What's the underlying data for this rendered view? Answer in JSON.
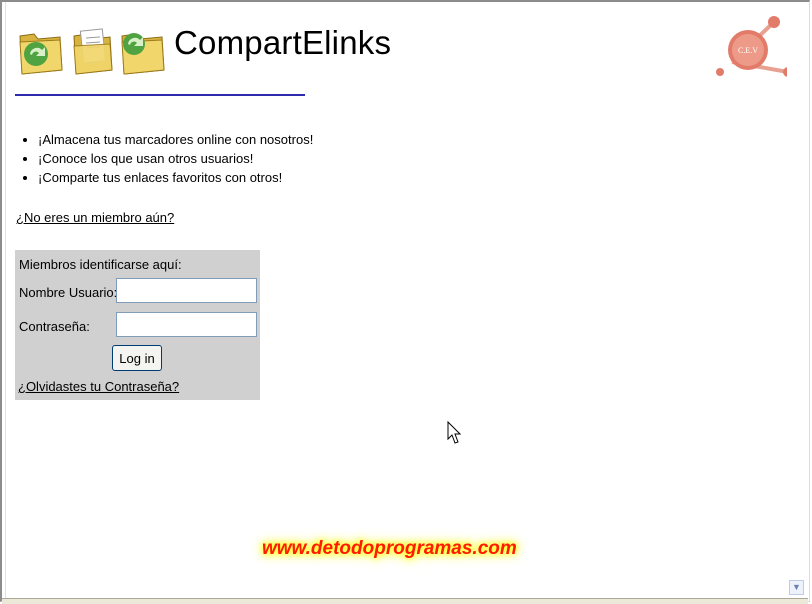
{
  "header": {
    "brand": "CompartElinks",
    "logo_text": "C.E.V"
  },
  "features": [
    "¡Almacena tus marcadores online con nosotros!",
    "¡Conoce los que usan otros usuarios!",
    "¡Comparte tus enlaces favoritos con otros!"
  ],
  "not_member_link": "¿No eres un miembro aún?",
  "login": {
    "title": "Miembros identificarse aquí:",
    "username_label": "Nombre Usuario:",
    "username_value": "",
    "password_label": "Contraseña:",
    "password_value": "",
    "submit_label": "Log in",
    "forgot_link": "¿Olvidastes tu Contraseña?"
  },
  "watermark": "www.detodoprogramas.com",
  "colors": {
    "rule": "#2d2bb0",
    "login_bg": "#d0d0d0",
    "watermark": "#ff1a00",
    "logo": "#e27b6a"
  },
  "icons": [
    "folder-refresh-icon",
    "document-icon",
    "folder-refresh-icon",
    "cev-logo-icon",
    "mouse-cursor-icon",
    "scroll-down-arrow-icon"
  ]
}
